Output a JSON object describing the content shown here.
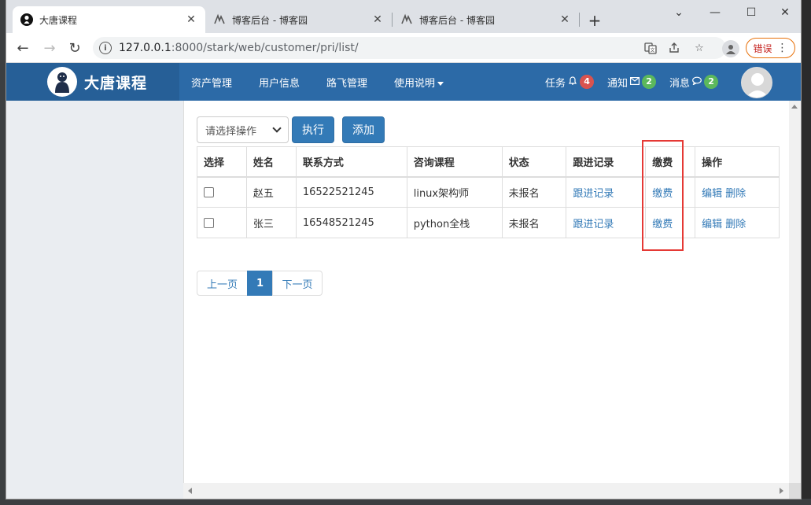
{
  "browser": {
    "tabs": [
      {
        "title": "大唐课程",
        "active": true
      },
      {
        "title": "博客后台 - 博客园",
        "active": false
      },
      {
        "title": "博客后台 - 博客园",
        "active": false
      }
    ],
    "url_host": "127.0.0.1",
    "url_rest": ":8000/stark/web/customer/pri/list/",
    "error_label": "错误"
  },
  "navbar": {
    "brand": "大唐课程",
    "menu": [
      "资产管理",
      "用户信息",
      "路飞管理",
      "使用说明"
    ],
    "tasks": {
      "label": "任务",
      "count": "4"
    },
    "notices": {
      "label": "通知",
      "count": "2"
    },
    "messages": {
      "label": "消息",
      "count": "2"
    }
  },
  "toolbar": {
    "select_placeholder": "请选择操作",
    "execute_label": "执行",
    "add_label": "添加"
  },
  "table": {
    "headers": [
      "选择",
      "姓名",
      "联系方式",
      "咨询课程",
      "状态",
      "跟进记录",
      "缴费",
      "操作"
    ],
    "rows": [
      {
        "name": "赵五",
        "phone": "16522521245",
        "course": "linux架构师",
        "status": "未报名",
        "followup": "跟进记录",
        "payment": "缴费",
        "edit": "编辑",
        "delete": "删除"
      },
      {
        "name": "张三",
        "phone": "16548521245",
        "course": "python全栈",
        "status": "未报名",
        "followup": "跟进记录",
        "payment": "缴费",
        "edit": "编辑",
        "delete": "删除"
      }
    ]
  },
  "pagination": {
    "prev": "上一页",
    "current": "1",
    "next": "下一页"
  },
  "colors": {
    "navbar": "#2c6aa7",
    "brand_bg": "#265f97",
    "primary": "#337ab7",
    "badge_red": "#d9534f",
    "badge_green": "#5cb85c",
    "highlight": "#e53935"
  }
}
